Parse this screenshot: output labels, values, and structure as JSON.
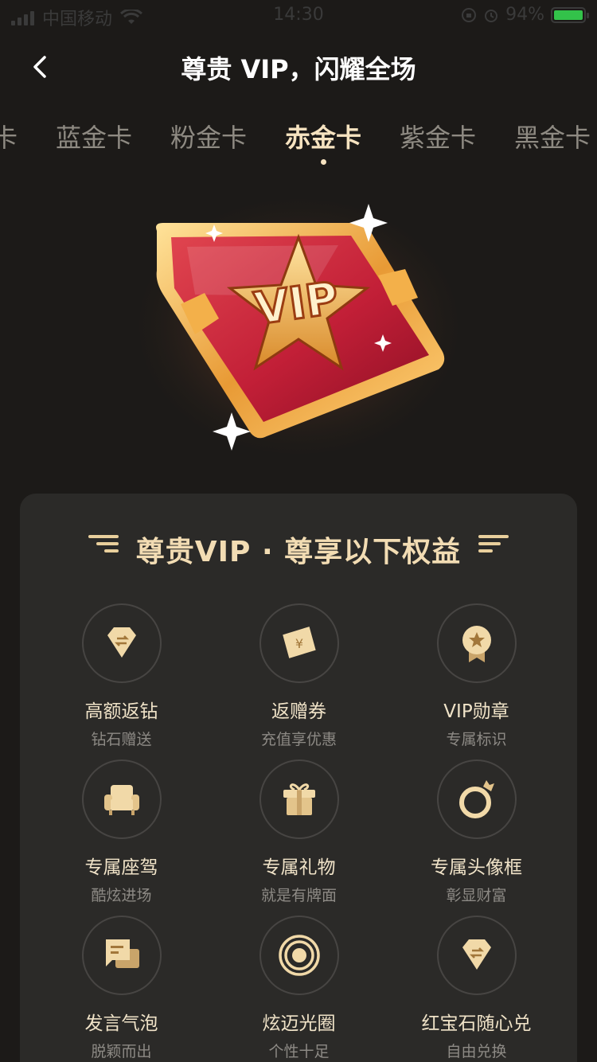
{
  "status_bar": {
    "carrier": "中国移动",
    "time": "14:30",
    "battery": "94%"
  },
  "nav": {
    "title": "尊贵 VIP，闪耀全场"
  },
  "tabs": [
    {
      "label": "卡"
    },
    {
      "label": "蓝金卡"
    },
    {
      "label": "粉金卡"
    },
    {
      "label": "赤金卡",
      "active": true
    },
    {
      "label": "紫金卡"
    },
    {
      "label": "黑金卡"
    }
  ],
  "card": {
    "badge_text": "VIP"
  },
  "benefits": {
    "title": "尊贵VIP · 尊享以下权益",
    "items": [
      {
        "name": "高额返钻",
        "desc": "钻石赠送",
        "icon": "diamond-icon"
      },
      {
        "name": "返赠券",
        "desc": "充值享优惠",
        "icon": "coupon-icon"
      },
      {
        "name": "VIP勋章",
        "desc": "专属标识",
        "icon": "medal-icon"
      },
      {
        "name": "专属座驾",
        "desc": "酷炫进场",
        "icon": "sofa-icon"
      },
      {
        "name": "专属礼物",
        "desc": "就是有牌面",
        "icon": "gift-icon"
      },
      {
        "name": "专属头像框",
        "desc": "彰显财富",
        "icon": "ring-icon"
      },
      {
        "name": "发言气泡",
        "desc": "脱颖而出",
        "icon": "chat-bubble-icon"
      },
      {
        "name": "炫迈光圈",
        "desc": "个性十足",
        "icon": "halo-icon"
      },
      {
        "name": "红宝石随心兑",
        "desc": "自由兑换",
        "icon": "gem-exchange-icon"
      }
    ]
  },
  "colors": {
    "background": "#1c1a18",
    "panel": "#2b2a28",
    "gold": "#f2dcb3",
    "tab_inactive": "#8e8a82"
  }
}
